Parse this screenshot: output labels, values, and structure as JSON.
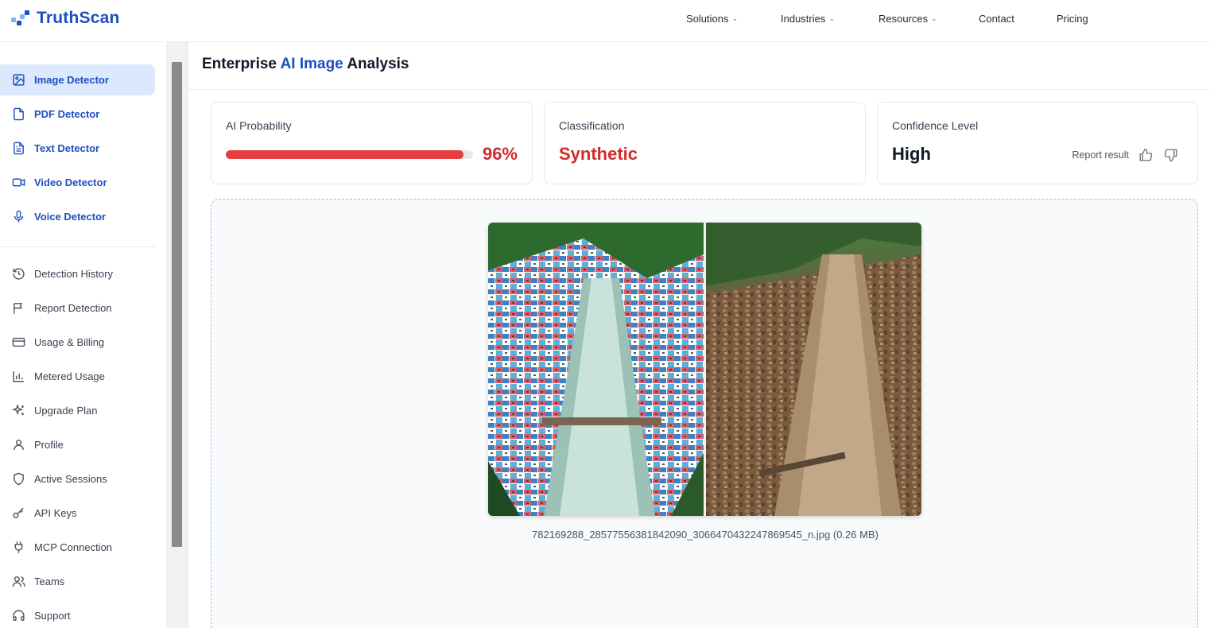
{
  "brand": {
    "name": "TruthScan",
    "colors": {
      "primary": "#1f4fbf",
      "logo_light": "#7fb3f5"
    }
  },
  "nav": {
    "items": [
      {
        "label": "Solutions",
        "dropdown": true
      },
      {
        "label": "Industries",
        "dropdown": true
      },
      {
        "label": "Resources",
        "dropdown": true
      },
      {
        "label": "Contact",
        "dropdown": false
      },
      {
        "label": "Pricing",
        "dropdown": false
      }
    ]
  },
  "sidebar": {
    "detectors": [
      {
        "label": "Image Detector",
        "icon": "image-icon",
        "active": true
      },
      {
        "label": "PDF Detector",
        "icon": "pdf-file-icon",
        "active": false
      },
      {
        "label": "Text Detector",
        "icon": "text-file-icon",
        "active": false
      },
      {
        "label": "Video Detector",
        "icon": "video-camera-icon",
        "active": false
      },
      {
        "label": "Voice Detector",
        "icon": "microphone-icon",
        "active": false
      }
    ],
    "account": [
      {
        "label": "Detection History",
        "icon": "history-icon"
      },
      {
        "label": "Report Detection",
        "icon": "flag-icon"
      },
      {
        "label": "Usage & Billing",
        "icon": "credit-card-icon"
      },
      {
        "label": "Metered Usage",
        "icon": "bar-chart-icon"
      },
      {
        "label": "Upgrade Plan",
        "icon": "sparkle-icon"
      },
      {
        "label": "Profile",
        "icon": "user-icon"
      },
      {
        "label": "Active Sessions",
        "icon": "shield-icon"
      },
      {
        "label": "API Keys",
        "icon": "key-icon"
      },
      {
        "label": "MCP Connection",
        "icon": "plug-icon"
      },
      {
        "label": "Teams",
        "icon": "users-icon"
      },
      {
        "label": "Support",
        "icon": "headset-icon"
      }
    ]
  },
  "page": {
    "title_prefix": "Enterprise ",
    "title_accent": "AI Image",
    "title_suffix": " Analysis"
  },
  "results": {
    "probability": {
      "label": "AI Probability",
      "value": 0.96,
      "display": "96%",
      "bar_color": "#e53e3e"
    },
    "classification": {
      "label": "Classification",
      "value": "Synthetic",
      "color": "#d12b2b"
    },
    "confidence": {
      "label": "Confidence Level",
      "value": "High",
      "report_label": "Report result"
    }
  },
  "upload": {
    "file_name": "782169288_28577556381842090_3066470432247869545_n.jpg",
    "file_size": "(0.26 MB)"
  }
}
